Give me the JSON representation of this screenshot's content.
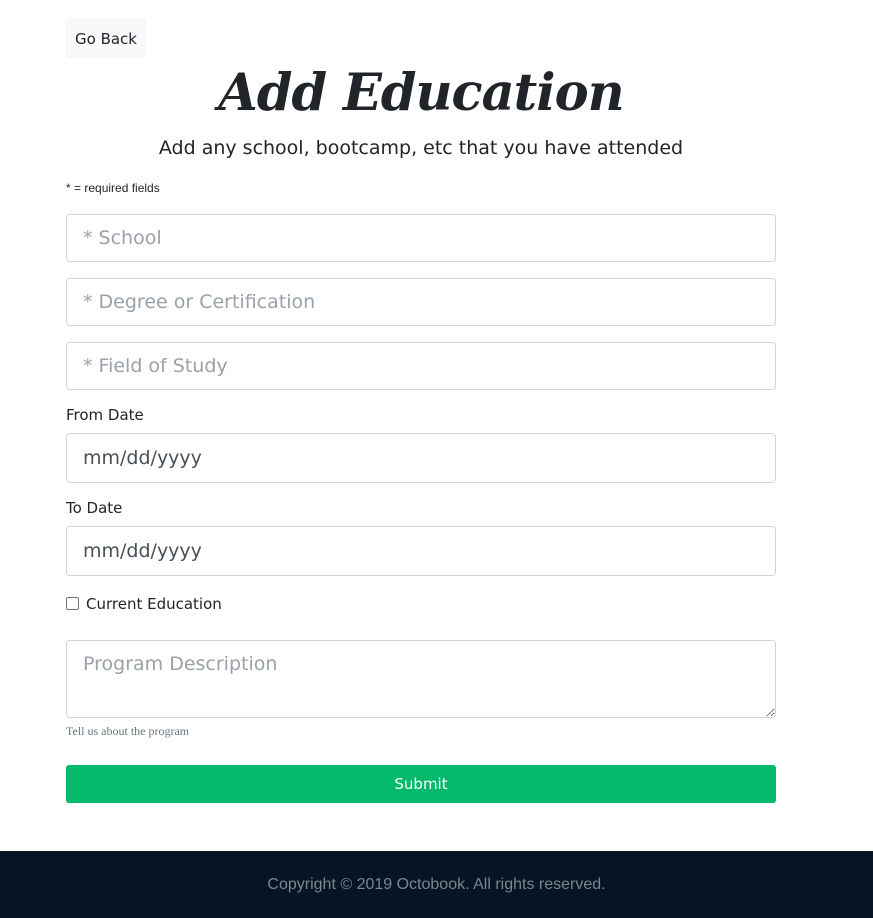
{
  "nav": {
    "go_back_label": "Go Back"
  },
  "header": {
    "title": "Add Education",
    "lead": "Add any school, bootcamp, etc that you have attended",
    "required_note": "* = required fields"
  },
  "form": {
    "school": {
      "placeholder": "* School",
      "value": ""
    },
    "degree": {
      "placeholder": "* Degree or Certification",
      "value": ""
    },
    "field_of_study": {
      "placeholder": "* Field of Study",
      "value": ""
    },
    "from_date": {
      "label": "From Date",
      "value": "mm/dd/yyyy"
    },
    "to_date": {
      "label": "To Date",
      "value": "mm/dd/yyyy"
    },
    "current": {
      "label": "Current Education",
      "checked": false
    },
    "description": {
      "placeholder": "Program Description",
      "help": "Tell us about the program"
    },
    "submit_label": "Submit"
  },
  "footer": {
    "copyright": "Copyright © 2019 Octobook. All rights reserved."
  },
  "colors": {
    "submit": "#04b86c",
    "footer_bg": "#061524"
  }
}
